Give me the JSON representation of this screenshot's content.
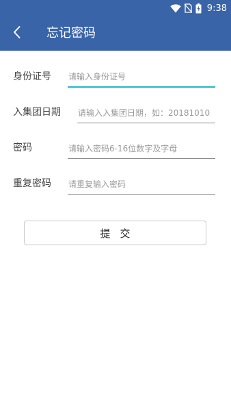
{
  "status_bar": {
    "time": "9:38",
    "icons": [
      "wifi-icon",
      "no-sim-icon",
      "battery-charging-icon"
    ]
  },
  "toolbar": {
    "back_icon": "chevron-left-icon",
    "title": "忘记密码"
  },
  "form": {
    "id_number": {
      "label": "身份证号",
      "placeholder": "请输入身份证号",
      "value": ""
    },
    "join_date": {
      "label": "入集团日期",
      "placeholder": "请输入入集团日期，如：20181010",
      "value": ""
    },
    "password": {
      "label": "密码",
      "placeholder": "请输入密码6-16位数字及字母",
      "value": ""
    },
    "confirm_password": {
      "label": "重复密码",
      "placeholder": "请重复输入密码",
      "value": ""
    },
    "submit_label": "提交"
  },
  "colors": {
    "primary": "#3a64a8",
    "focus_underline": "#21b6c9"
  }
}
